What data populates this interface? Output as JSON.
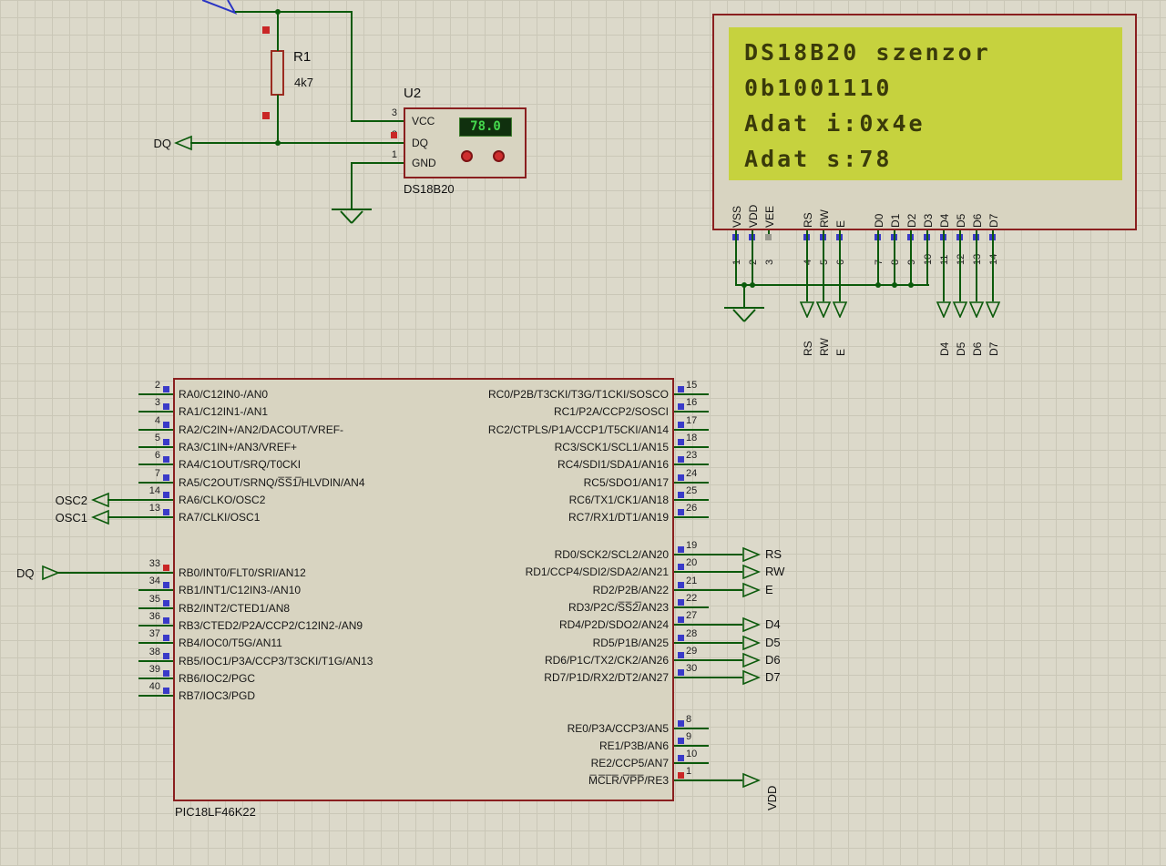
{
  "colors": {
    "background": "#dcd9ca",
    "grid_line": "#cac7b7",
    "wire": "#0b5a0b",
    "component_border": "#8a1f1f",
    "component_fill": "#d8d4c1",
    "lcd_screen": "#c6d23e",
    "lcd_text": "#3a3a0a",
    "pin_blue": "#3a3ac8",
    "pin_red": "#c92626",
    "pin_gray": "#9a998f",
    "display_bg": "#10300e",
    "display_text": "#45d84d",
    "power_terminal_blue": "#2b35c4"
  },
  "resistor": {
    "ref": "R1",
    "value": "4k7"
  },
  "sensor": {
    "ref": "U2",
    "part": "DS18B20",
    "display_value": "78.0",
    "pins": [
      {
        "num": "3",
        "name": "VCC"
      },
      {
        "num": "2",
        "name": "DQ"
      },
      {
        "num": "1",
        "name": "GND"
      }
    ]
  },
  "terminals": {
    "dq_top": "DQ",
    "osc2": "OSC2",
    "osc1": "OSC1",
    "dq_bottom": "DQ"
  },
  "lcd": {
    "lines": [
      "DS18B20 szenzor",
      "0b1001110",
      "Adat i:0x4e",
      "Adat s:78"
    ],
    "pins": [
      {
        "num": "1",
        "name": "VSS",
        "sq": "blue",
        "wire": "gnd"
      },
      {
        "num": "2",
        "name": "VDD",
        "sq": "blue",
        "wire": "gnd"
      },
      {
        "num": "3",
        "name": "VEE",
        "sq": "gray",
        "wire": "none"
      },
      {
        "num": "4",
        "name": "RS",
        "sq": "blue",
        "wire": "arrow",
        "label": "RS"
      },
      {
        "num": "5",
        "name": "RW",
        "sq": "blue",
        "wire": "arrow",
        "label": "RW"
      },
      {
        "num": "6",
        "name": "E",
        "sq": "blue",
        "wire": "arrow",
        "label": "E"
      },
      {
        "num": "7",
        "name": "D0",
        "sq": "blue",
        "wire": "gnd"
      },
      {
        "num": "8",
        "name": "D1",
        "sq": "blue",
        "wire": "gnd"
      },
      {
        "num": "9",
        "name": "D2",
        "sq": "blue",
        "wire": "gnd"
      },
      {
        "num": "10",
        "name": "D3",
        "sq": "blue",
        "wire": "gnd"
      },
      {
        "num": "11",
        "name": "D4",
        "sq": "blue",
        "wire": "arrow",
        "label": "D4"
      },
      {
        "num": "12",
        "name": "D5",
        "sq": "blue",
        "wire": "arrow",
        "label": "D5"
      },
      {
        "num": "13",
        "name": "D6",
        "sq": "blue",
        "wire": "arrow",
        "label": "D6"
      },
      {
        "num": "14",
        "name": "D7",
        "sq": "blue",
        "wire": "arrow",
        "label": "D7"
      }
    ]
  },
  "mcu": {
    "part": "PIC18LF46K22",
    "left_pins": [
      {
        "num": "2",
        "name": "RA0/C12IN0-/AN0"
      },
      {
        "num": "3",
        "name": "RA1/C12IN1-/AN1"
      },
      {
        "num": "4",
        "name": "RA2/C2IN+/AN2/DACOUT/VREF-"
      },
      {
        "num": "5",
        "name": "RA3/C1IN+/AN3/VREF+"
      },
      {
        "num": "6",
        "name": "RA4/C1OUT/SRQ/T0CKI"
      },
      {
        "num": "7",
        "name": "RA5/C2OUT/SRNQ/S̅S̅1̅/HLVDIN/AN4"
      },
      {
        "num": "14",
        "name": "RA6/CLKO/OSC2",
        "conn": "OSC2"
      },
      {
        "num": "13",
        "name": "RA7/CLKI/OSC1",
        "conn": "OSC1"
      },
      {
        "num": "33",
        "name": "RB0/INT0/FLT0/SRI/AN12",
        "conn": "DQ",
        "sq": "red"
      },
      {
        "num": "34",
        "name": "RB1/INT1/C12IN3-/AN10"
      },
      {
        "num": "35",
        "name": "RB2/INT2/CTED1/AN8"
      },
      {
        "num": "36",
        "name": "RB3/CTED2/P2A/CCP2/C12IN2-/AN9"
      },
      {
        "num": "37",
        "name": "RB4/IOC0/T5G/AN11"
      },
      {
        "num": "38",
        "name": "RB5/IOC1/P3A/CCP3/T3CKI/T1G/AN13"
      },
      {
        "num": "39",
        "name": "RB6/IOC2/PGC"
      },
      {
        "num": "40",
        "name": "RB7/IOC3/PGD"
      }
    ],
    "right_pins": [
      {
        "num": "15",
        "name": "RC0/P2B/T3CKI/T3G/T1CKI/SOSCO"
      },
      {
        "num": "16",
        "name": "RC1/P2A/CCP2/SOSCI"
      },
      {
        "num": "17",
        "name": "RC2/CTPLS/P1A/CCP1/T5CKI/AN14"
      },
      {
        "num": "18",
        "name": "RC3/SCK1/SCL1/AN15"
      },
      {
        "num": "23",
        "name": "RC4/SDI1/SDA1/AN16"
      },
      {
        "num": "24",
        "name": "RC5/SDO1/AN17"
      },
      {
        "num": "25",
        "name": "RC6/TX1/CK1/AN18"
      },
      {
        "num": "26",
        "name": "RC7/RX1/DT1/AN19"
      },
      {
        "num": "19",
        "name": "RD0/SCK2/SCL2/AN20",
        "conn": "RS"
      },
      {
        "num": "20",
        "name": "RD1/CCP4/SDI2/SDA2/AN21",
        "conn": "RW"
      },
      {
        "num": "21",
        "name": "RD2/P2B/AN22",
        "conn": "E"
      },
      {
        "num": "22",
        "name": "RD3/P2C/S̅S̅2̅/AN23"
      },
      {
        "num": "27",
        "name": "RD4/P2D/SDO2/AN24",
        "conn": "D4"
      },
      {
        "num": "28",
        "name": "RD5/P1B/AN25",
        "conn": "D5"
      },
      {
        "num": "29",
        "name": "RD6/P1C/TX2/CK2/AN26",
        "conn": "D6"
      },
      {
        "num": "30",
        "name": "RD7/P1D/RX2/DT2/AN27",
        "conn": "D7"
      },
      {
        "num": "8",
        "name": "RE0/P3A/CCP3/AN5"
      },
      {
        "num": "9",
        "name": "RE1/P3B/AN6"
      },
      {
        "num": "10",
        "name": "RE2/CCP5/AN7"
      },
      {
        "num": "1",
        "name": "M̅C̅L̅R̅/V̅P̅P̅/RE3",
        "conn": "VDD",
        "conn_rotated": true,
        "sq": "red"
      }
    ]
  }
}
